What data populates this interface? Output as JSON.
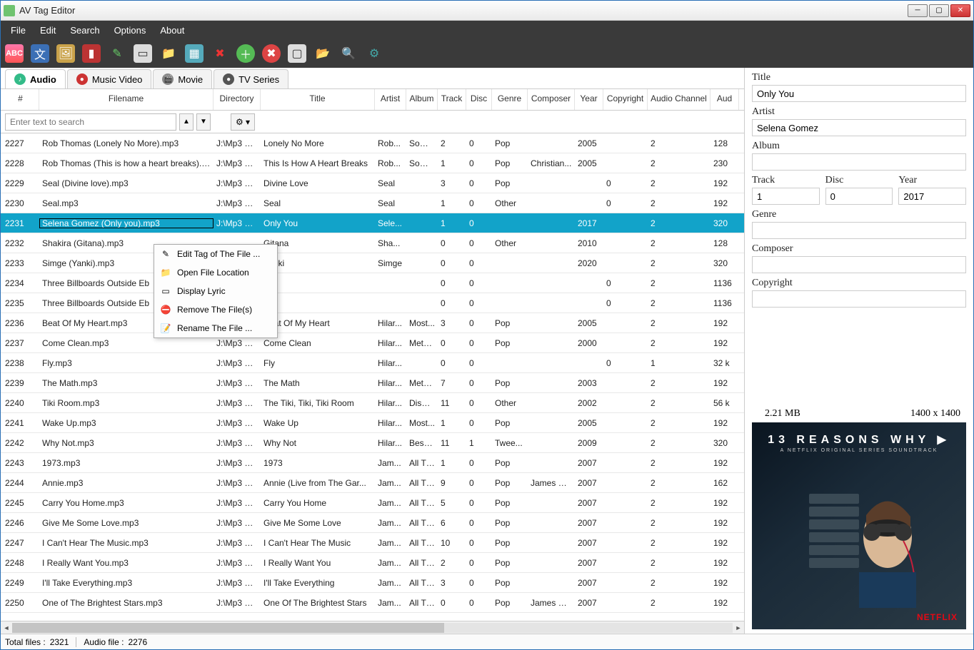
{
  "window": {
    "title": "AV Tag Editor"
  },
  "menu": [
    "File",
    "Edit",
    "Search",
    "Options",
    "About"
  ],
  "tabs": [
    {
      "label": "Audio",
      "active": true
    },
    {
      "label": "Music Video",
      "active": false
    },
    {
      "label": "Movie",
      "active": false
    },
    {
      "label": "TV Series",
      "active": false
    }
  ],
  "columns": [
    "#",
    "Filename",
    "Directory",
    "Title",
    "Artist",
    "Album",
    "Track",
    "Disc",
    "Genre",
    "Composer",
    "Year",
    "Copyright",
    "Audio Channel",
    "Aud"
  ],
  "search_placeholder": "Enter text to search",
  "rows": [
    {
      "n": "2227",
      "file": "Rob Thomas (Lonely No More).mp3",
      "dir": "J:\\Mp3 M...",
      "title": "Lonely No More",
      "artist": "Rob...",
      "album": "Some...",
      "track": "2",
      "disc": "0",
      "genre": "Pop",
      "comp": "",
      "year": "2005",
      "copy": "",
      "chan": "2",
      "aud": "128"
    },
    {
      "n": "2228",
      "file": "Rob Thomas (This is how a heart breaks).mp3",
      "dir": "J:\\Mp3 M...",
      "title": "This Is How A Heart Breaks",
      "artist": "Rob...",
      "album": "Some...",
      "track": "1",
      "disc": "0",
      "genre": "Pop",
      "comp": "Christian...",
      "year": "2005",
      "copy": "",
      "chan": "2",
      "aud": "230"
    },
    {
      "n": "2229",
      "file": "Seal (Divine love).mp3",
      "dir": "J:\\Mp3 M...",
      "title": "Divine Love",
      "artist": "Seal",
      "album": "",
      "track": "3",
      "disc": "0",
      "genre": "Pop",
      "comp": "",
      "year": "",
      "copy": "0",
      "chan": "2",
      "aud": "192"
    },
    {
      "n": "2230",
      "file": "Seal.mp3",
      "dir": "J:\\Mp3 M...",
      "title": "Seal",
      "artist": "Seal",
      "album": "",
      "track": "1",
      "disc": "0",
      "genre": "Other",
      "comp": "",
      "year": "",
      "copy": "0",
      "chan": "2",
      "aud": "192"
    },
    {
      "n": "2231",
      "file": "Selena Gomez (Only you).mp3",
      "dir": "J:\\Mp3 M...",
      "title": "Only You",
      "artist": "Sele...",
      "album": "",
      "track": "1",
      "disc": "0",
      "genre": "",
      "comp": "",
      "year": "2017",
      "copy": "",
      "chan": "2",
      "aud": "320",
      "selected": true
    },
    {
      "n": "2232",
      "file": "Shakira (Gitana).mp3",
      "dir": "",
      "title": "Gitana",
      "artist": "Sha...",
      "album": "",
      "track": "0",
      "disc": "0",
      "genre": "Other",
      "comp": "",
      "year": "2010",
      "copy": "",
      "chan": "2",
      "aud": "128"
    },
    {
      "n": "2233",
      "file": "Simge (Yanki).mp3",
      "dir": "",
      "title": "Yanki",
      "artist": "Simge",
      "album": "",
      "track": "0",
      "disc": "0",
      "genre": "",
      "comp": "",
      "year": "2020",
      "copy": "",
      "chan": "2",
      "aud": "320"
    },
    {
      "n": "2234",
      "file": "Three Billboards Outside Eb",
      "dir": "",
      "title": "",
      "artist": "",
      "album": "",
      "track": "0",
      "disc": "0",
      "genre": "",
      "comp": "",
      "year": "",
      "copy": "0",
      "chan": "2",
      "aud": "1136"
    },
    {
      "n": "2235",
      "file": "Three Billboards Outside Eb",
      "dir": "",
      "title": "",
      "artist": "",
      "album": "",
      "track": "0",
      "disc": "0",
      "genre": "",
      "comp": "",
      "year": "",
      "copy": "0",
      "chan": "2",
      "aud": "1136"
    },
    {
      "n": "2236",
      "file": "Beat Of My Heart.mp3",
      "dir": "J:\\Mp3 M...",
      "title": "Beat Of My Heart",
      "artist": "Hilar...",
      "album": "Most...",
      "track": "3",
      "disc": "0",
      "genre": "Pop",
      "comp": "",
      "year": "2005",
      "copy": "",
      "chan": "2",
      "aud": "192"
    },
    {
      "n": "2237",
      "file": "Come Clean.mp3",
      "dir": "J:\\Mp3 M...",
      "title": "Come Clean",
      "artist": "Hilar...",
      "album": "Meta...",
      "track": "0",
      "disc": "0",
      "genre": "Pop",
      "comp": "",
      "year": "2000",
      "copy": "",
      "chan": "2",
      "aud": "192"
    },
    {
      "n": "2238",
      "file": "Fly.mp3",
      "dir": "J:\\Mp3 M...",
      "title": "Fly",
      "artist": "Hilar...",
      "album": "",
      "track": "0",
      "disc": "0",
      "genre": "",
      "comp": "",
      "year": "",
      "copy": "0",
      "chan": "1",
      "aud": "32 k"
    },
    {
      "n": "2239",
      "file": "The Math.mp3",
      "dir": "J:\\Mp3 M...",
      "title": "The Math",
      "artist": "Hilar...",
      "album": "Meta...",
      "track": "7",
      "disc": "0",
      "genre": "Pop",
      "comp": "",
      "year": "2003",
      "copy": "",
      "chan": "2",
      "aud": "192"
    },
    {
      "n": "2240",
      "file": "Tiki Room.mp3",
      "dir": "J:\\Mp3 M...",
      "title": "The Tiki, Tiki, Tiki Room",
      "artist": "Hilar...",
      "album": "Disne...",
      "track": "11",
      "disc": "0",
      "genre": "Other",
      "comp": "",
      "year": "2002",
      "copy": "",
      "chan": "2",
      "aud": "56 k"
    },
    {
      "n": "2241",
      "file": "Wake Up.mp3",
      "dir": "J:\\Mp3 M...",
      "title": "Wake Up",
      "artist": "Hilar...",
      "album": "Most...",
      "track": "1",
      "disc": "0",
      "genre": "Pop",
      "comp": "",
      "year": "2005",
      "copy": "",
      "chan": "2",
      "aud": "192"
    },
    {
      "n": "2242",
      "file": "Why Not.mp3",
      "dir": "J:\\Mp3 M...",
      "title": "Why Not",
      "artist": "Hilar...",
      "album": "Best o...",
      "track": "11",
      "disc": "1",
      "genre": "Twee...",
      "comp": "",
      "year": "2009",
      "copy": "",
      "chan": "2",
      "aud": "320"
    },
    {
      "n": "2243",
      "file": "1973.mp3",
      "dir": "J:\\Mp3 M...",
      "title": "1973",
      "artist": "Jam...",
      "album": "All Th...",
      "track": "1",
      "disc": "0",
      "genre": "Pop",
      "comp": "",
      "year": "2007",
      "copy": "",
      "chan": "2",
      "aud": "192"
    },
    {
      "n": "2244",
      "file": "Annie.mp3",
      "dir": "J:\\Mp3 M...",
      "title": "Annie (Live from The Gar...",
      "artist": "Jam...",
      "album": "All Th...",
      "track": "9",
      "disc": "0",
      "genre": "Pop",
      "comp": "James Blunt",
      "year": "2007",
      "copy": "",
      "chan": "2",
      "aud": "162"
    },
    {
      "n": "2245",
      "file": "Carry You Home.mp3",
      "dir": "J:\\Mp3 M...",
      "title": "Carry You Home",
      "artist": "Jam...",
      "album": "All Th...",
      "track": "5",
      "disc": "0",
      "genre": "Pop",
      "comp": "",
      "year": "2007",
      "copy": "",
      "chan": "2",
      "aud": "192"
    },
    {
      "n": "2246",
      "file": "Give Me Some Love.mp3",
      "dir": "J:\\Mp3 M...",
      "title": "Give Me Some Love",
      "artist": "Jam...",
      "album": "All Th...",
      "track": "6",
      "disc": "0",
      "genre": "Pop",
      "comp": "",
      "year": "2007",
      "copy": "",
      "chan": "2",
      "aud": "192"
    },
    {
      "n": "2247",
      "file": "I Can't Hear The Music.mp3",
      "dir": "J:\\Mp3 M...",
      "title": "I Can't Hear The Music",
      "artist": "Jam...",
      "album": "All Th...",
      "track": "10",
      "disc": "0",
      "genre": "Pop",
      "comp": "",
      "year": "2007",
      "copy": "",
      "chan": "2",
      "aud": "192"
    },
    {
      "n": "2248",
      "file": "I Really Want You.mp3",
      "dir": "J:\\Mp3 M...",
      "title": "I Really Want You",
      "artist": "Jam...",
      "album": "All Th...",
      "track": "2",
      "disc": "0",
      "genre": "Pop",
      "comp": "",
      "year": "2007",
      "copy": "",
      "chan": "2",
      "aud": "192"
    },
    {
      "n": "2249",
      "file": "I'll Take Everything.mp3",
      "dir": "J:\\Mp3 M...",
      "title": "I'll Take Everything",
      "artist": "Jam...",
      "album": "All Th...",
      "track": "3",
      "disc": "0",
      "genre": "Pop",
      "comp": "",
      "year": "2007",
      "copy": "",
      "chan": "2",
      "aud": "192"
    },
    {
      "n": "2250",
      "file": "One of The Brightest Stars.mp3",
      "dir": "J:\\Mp3 M...",
      "title": "One Of The Brightest Stars",
      "artist": "Jam...",
      "album": "All Th...",
      "track": "0",
      "disc": "0",
      "genre": "Pop",
      "comp": "James Blunt",
      "year": "2007",
      "copy": "",
      "chan": "2",
      "aud": "192"
    }
  ],
  "context": [
    {
      "icon": "✎",
      "label": "Edit Tag of The File ..."
    },
    {
      "icon": "📁",
      "label": "Open File Location"
    },
    {
      "icon": "▭",
      "label": "Display Lyric"
    },
    {
      "icon": "⛔",
      "label": "Remove The File(s)"
    },
    {
      "icon": "📝",
      "label": "Rename The File ..."
    }
  ],
  "details": {
    "title_label": "Title",
    "title": "Only You",
    "artist_label": "Artist",
    "artist": "Selena Gomez",
    "album_label": "Album",
    "album": "",
    "track_label": "Track",
    "track": "1",
    "disc_label": "Disc",
    "disc": "0",
    "year_label": "Year",
    "year": "2017",
    "genre_label": "Genre",
    "genre": "",
    "composer_label": "Composer",
    "composer": "",
    "copyright_label": "Copyright",
    "copyright": "",
    "filesize": "2.21 MB",
    "artdim": "1400 x 1400",
    "art_title": "13 REASONS WHY ▶",
    "art_sub": "A NETFLIX ORIGINAL SERIES SOUNDTRACK",
    "art_brand": "NETFLIX"
  },
  "status": {
    "total_label": "Total files :",
    "total": "2321",
    "audio_label": "Audio file :",
    "audio": "2276"
  }
}
